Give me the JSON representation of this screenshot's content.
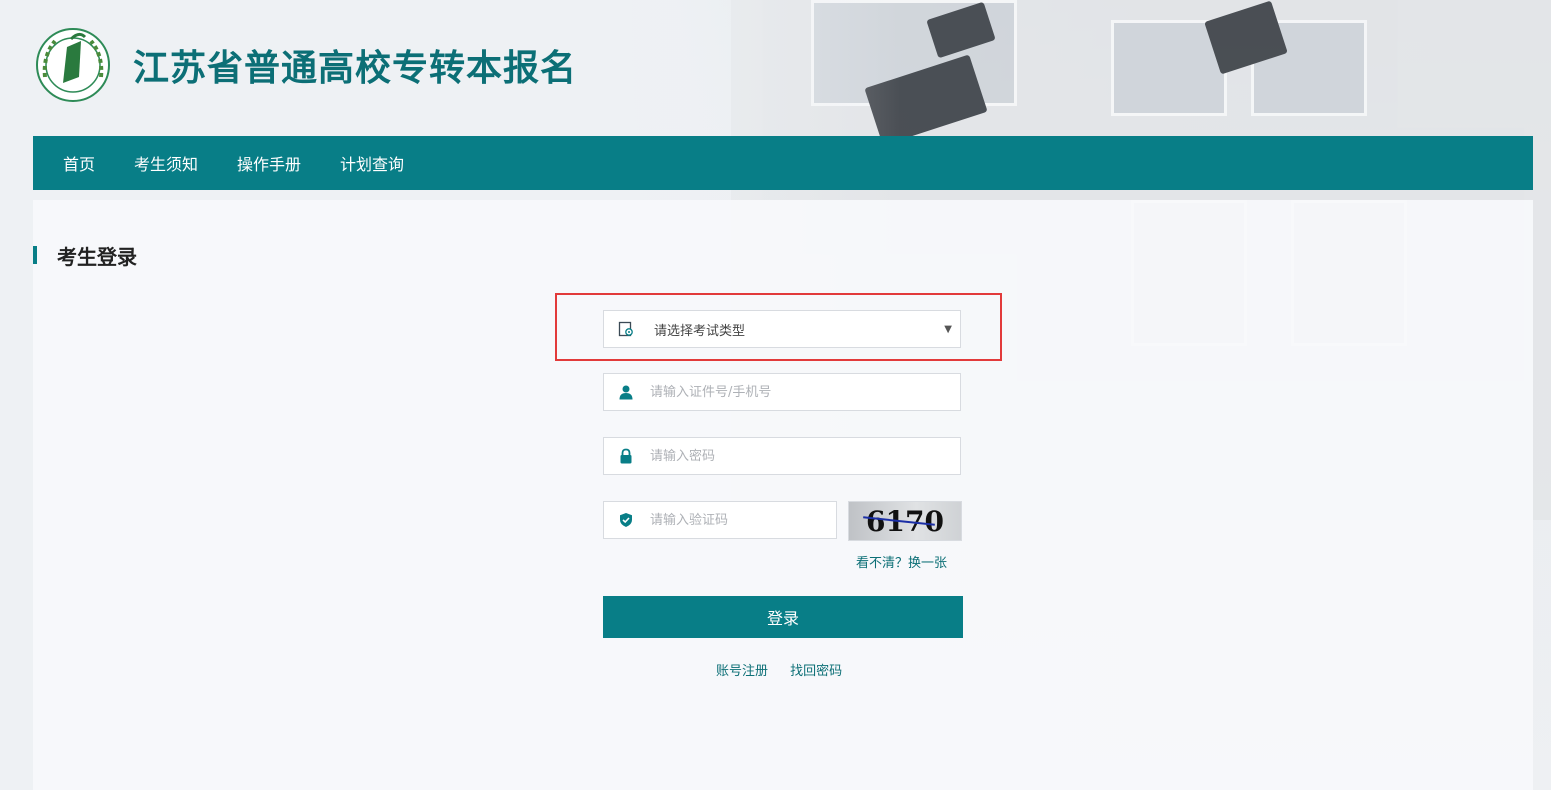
{
  "header": {
    "title": "江苏省普通高校专转本报名"
  },
  "nav": {
    "items": [
      {
        "label": "首页"
      },
      {
        "label": "考生须知"
      },
      {
        "label": "操作手册"
      },
      {
        "label": "计划查询"
      }
    ]
  },
  "login": {
    "section_title": "考生登录",
    "exam_type_placeholder": "请选择考试类型",
    "id_placeholder": "请输入证件号/手机号",
    "password_placeholder": "请输入密码",
    "captcha_placeholder": "请输入验证码",
    "captcha_value": "6170",
    "refresh_label": "看不清？换一张",
    "login_button": "登录",
    "register_link": "账号注册",
    "recover_link": "找回密码"
  },
  "colors": {
    "brand": "#087e87",
    "title": "#0c6f76",
    "highlight_border": "#e23a3a"
  },
  "icons": {
    "exam_type": "exam-type-icon",
    "user": "user-icon",
    "lock": "lock-icon",
    "shield": "shield-check-icon",
    "caret": "caret-down-icon",
    "logo": "school-emblem-logo"
  }
}
